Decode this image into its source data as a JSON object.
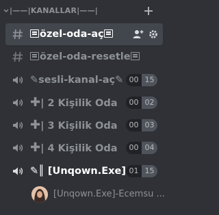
{
  "category": {
    "label": "|——|KANALLAR|——|"
  },
  "channels": [
    {
      "type": "text",
      "name": "özel-oda-aç",
      "selected": true
    },
    {
      "type": "text",
      "name": "özel-oda-resetle"
    },
    {
      "type": "voice",
      "name": "sesli-kanal-aç",
      "users": "00",
      "cap": "15"
    },
    {
      "type": "voice",
      "name": "| 2 Kişilik Oda",
      "users": "00",
      "cap": "02"
    },
    {
      "type": "voice",
      "name": "| 3 Kişilik Oda",
      "users": "00",
      "cap": "03"
    },
    {
      "type": "voice",
      "name": "| 4 Kişilik Oda",
      "users": "00",
      "cap": "04"
    },
    {
      "type": "voice",
      "name": "║ [Unqown.Exe]...",
      "users": "01",
      "cap": "15"
    }
  ],
  "voice_user": {
    "name": "[Unqown.Exe]-Ecemsu ..."
  }
}
